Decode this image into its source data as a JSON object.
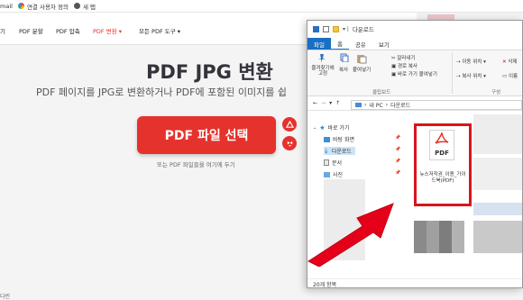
{
  "bookmarks": {
    "items": [
      {
        "label": "mail",
        "icon": "none"
      },
      {
        "label": "연결 사용자 정의",
        "icon": "google-icon"
      },
      {
        "label": "새 탭",
        "icon": "globe-icon"
      }
    ]
  },
  "sitenav": {
    "items": [
      "기",
      "PDF 분할",
      "PDF 압축",
      "PDF 변환 ▾",
      "모든 PDF 도구 ▾"
    ],
    "active_index": 3
  },
  "hero": {
    "title": "PDF JPG 변환",
    "subtitle": "PDF 페이지를 JPG로 변환하거나 PDF에 포함된 이미지를 쉽",
    "select_button": "PDF 파일 선택",
    "drop_text": "또는 PDF 파일들을 여기에 두기"
  },
  "status_text": "다린",
  "explorer": {
    "title": "다운로드",
    "tabs": [
      "파일",
      "홈",
      "공유",
      "보기"
    ],
    "ribbon": {
      "pin_label": "즐겨찾기에 고정",
      "copy_label": "복사",
      "paste_label": "붙여넣기",
      "cut_label": "잘라내기",
      "copy_path_label": "경로 복사",
      "paste_shortcut_label": "바로 가기 붙여넣기",
      "clipboard_group": "클립보드",
      "move_to_label": "이동 위치 ▾",
      "copy_to_label": "복사 위치 ▾",
      "delete_label": "삭제",
      "rename_label": "이름",
      "organize_group": "구성"
    },
    "address": {
      "path": [
        "내 PC",
        "다운로드"
      ]
    },
    "nav_items": [
      {
        "label": "바로 가기",
        "icon": "star-icon"
      },
      {
        "label": "바탕 화면",
        "icon": "desktop-icon"
      },
      {
        "label": "다운로드",
        "icon": "download-icon"
      },
      {
        "label": "문서",
        "icon": "document-icon"
      },
      {
        "label": "사진",
        "icon": "picture-icon"
      }
    ],
    "pdf_file": {
      "icon_label": "PDF",
      "name": "뉴스저작권_이용_가이드북(PDF)"
    },
    "status": "20개 항목"
  },
  "colors": {
    "brand_red": "#e5322d",
    "highlight_red": "#d8151c",
    "explorer_blue": "#1a6fc4"
  }
}
